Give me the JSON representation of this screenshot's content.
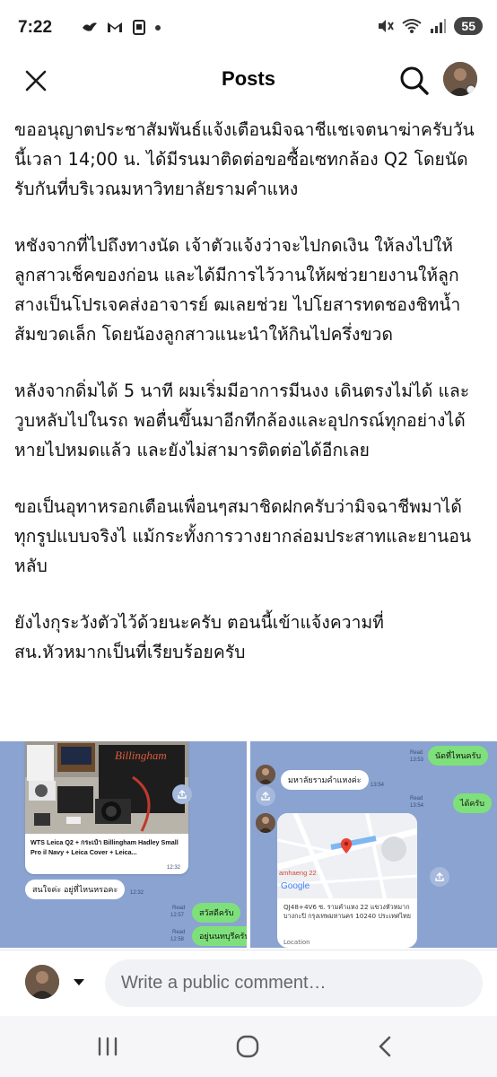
{
  "status_bar": {
    "time": "7:22",
    "battery": "55",
    "signal_small": "6"
  },
  "header": {
    "title": "Posts",
    "icons": [
      "close-icon",
      "search-icon",
      "avatar"
    ]
  },
  "post": {
    "paragraphs": [
      "ขออนุญาตประชาสัมพันธ์แจ้งเตือนมิจฉาชีแชเจตนาฆ่าครับวันนี้เวลา 14;00 น. ได้มีรนมาติดต่อขอซื้อเซทกล้อง Q2 โดยนัดรับกันที่บริเวณมหาวิทยาลัยรามคำแหง",
      "หชังจากที่ไปถึงทางนัด เจ้าตัวแจ้งว่าจะไปกดเงิน ให้ลงไปให้ลูกสาวเช็คของก่อน และได้มีการไว้วานให้ผช่วยายงานให้ลูกสางเป็นโปรเจคส่งอาจารย์ ฒเลยช่วย ไปโยสารทดชองชิทน้ำส้มขวดเล็ก โดยน้องลูกสาวแนะนำให้กินไปครึ่งขวด",
      "หลังจากดิ่มได้ 5 นาที ผมเริ่มมีอาการมีนงง เดินตรงไม่ได้ และวูบหลับไปในรถ พอตื่นขึ้นมาอีกทีกล้องและอุปกรณ์ทุกอย่างได้หายไปหมดแล้ว และยังไม่สามารติดต่อได้อีกเลย",
      "ขอเป็นอุทาหรอกเตือนเพื่อนๆสมาชิดฝกครับว่ามิจฉาชีพมาได้ทุกรูปแบบจริงไ แม้กระทั้งการวางยากล่อมประสาทและยานอนหลับ",
      "ยังไงกุระวังตัวไว้ด้วยนะครับ ตอนนี้เข้าแจ้งความที่ สน.หัวหมากเป็นที่เรียบร้อยครับ"
    ]
  },
  "chat_left": {
    "photo_brand": "Billingham",
    "listing_caption": "WTS Leica Q2 + กระเป๋า Billingham Hadley Small Pro il Navy + Leica Cover + Leica...",
    "listing_time": "12:32",
    "reply_bubble": "สนใจค่ะ อยู่ที่ไหนหรอคะ",
    "reply_time": "12:32",
    "msg1": "สวัสดีครับ",
    "msg1_read": "Read",
    "msg1_time": "12:57",
    "msg2": "อยู่นนทบุรีครับ",
    "msg2_read": "Read",
    "msg2_time": "12:58"
  },
  "chat_right": {
    "top_msg": "นัดที่ไหนครับ",
    "top_read": "Read",
    "top_time": "13:53",
    "place_msg": "มหาลัยรามคำแหงค่ะ",
    "place_time": "13:54",
    "ok_msg": "ได้ครับ",
    "ok_read": "Read",
    "ok_time": "13:54",
    "map_road_label": "amhaeng 22",
    "map_provider": "Google",
    "map_address": "QJ48+4V6 ซ. รามคำแหง 22 แขวงหัวหมาก บางกะปิ กรุงเทพมหานคร 10240 ประเทศไทย",
    "map_location": "Location"
  },
  "comment_bar": {
    "placeholder": "Write a public comment…"
  },
  "nav_bar": {
    "icons": [
      "recent-apps-icon",
      "home-icon",
      "back-icon"
    ]
  },
  "colors": {
    "chat_background": "#8aa3d1",
    "green_bubble": "#7ee07a",
    "comment_field": "#f0f2f5"
  }
}
